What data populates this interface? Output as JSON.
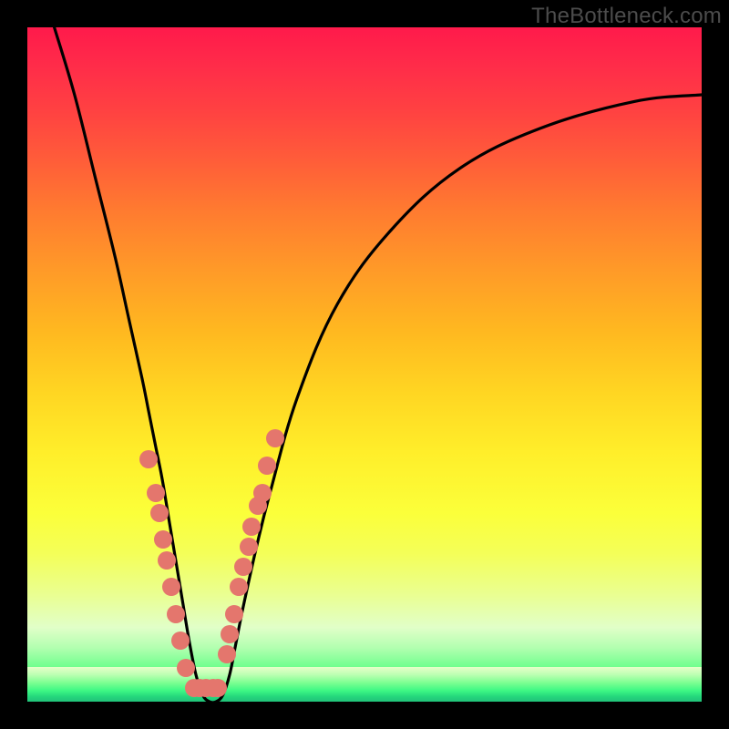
{
  "watermark": "TheBottleneck.com",
  "colors": {
    "frame": "#000000",
    "curve": "#000000",
    "dot": "#e4766d"
  },
  "chart_data": {
    "type": "line",
    "title": "",
    "xlabel": "",
    "ylabel": "",
    "xlim": [
      0,
      100
    ],
    "ylim": [
      0,
      100
    ],
    "grid": false,
    "curve": {
      "name": "bottleneck-curve",
      "description": "V-shaped bottleneck percentage curve. Minimum (0%) near x≈25–28; rises steeply on both sides.",
      "x": [
        4,
        7,
        10,
        13,
        15,
        17,
        18,
        19,
        20,
        21,
        22,
        23,
        24,
        25,
        26,
        27,
        28,
        29,
        30,
        31,
        32,
        34,
        36,
        40,
        46,
        54,
        64,
        76,
        90,
        100
      ],
      "y": [
        100,
        90,
        78,
        66,
        57,
        48,
        43,
        38,
        33,
        27,
        21,
        15,
        9,
        4,
        1,
        0,
        0,
        1,
        4,
        9,
        14,
        23,
        31,
        45,
        59,
        70,
        79,
        85,
        89,
        90
      ]
    },
    "markers": {
      "name": "sample-points",
      "color": "#e4766d",
      "points": [
        {
          "x": 18.0,
          "y": 36
        },
        {
          "x": 19.0,
          "y": 31
        },
        {
          "x": 19.6,
          "y": 28
        },
        {
          "x": 20.2,
          "y": 24
        },
        {
          "x": 20.7,
          "y": 21
        },
        {
          "x": 21.3,
          "y": 17
        },
        {
          "x": 22.0,
          "y": 13
        },
        {
          "x": 22.7,
          "y": 9
        },
        {
          "x": 23.5,
          "y": 5
        },
        {
          "x": 24.7,
          "y": 2
        },
        {
          "x": 25.5,
          "y": 2
        },
        {
          "x": 26.5,
          "y": 2
        },
        {
          "x": 27.5,
          "y": 2
        },
        {
          "x": 28.3,
          "y": 2
        },
        {
          "x": 29.6,
          "y": 7
        },
        {
          "x": 30.0,
          "y": 10
        },
        {
          "x": 30.7,
          "y": 13
        },
        {
          "x": 31.3,
          "y": 17
        },
        {
          "x": 32.0,
          "y": 20
        },
        {
          "x": 32.8,
          "y": 23
        },
        {
          "x": 33.3,
          "y": 26
        },
        {
          "x": 34.2,
          "y": 29
        },
        {
          "x": 34.8,
          "y": 31
        },
        {
          "x": 35.6,
          "y": 35
        },
        {
          "x": 36.8,
          "y": 39
        }
      ]
    },
    "background": {
      "type": "vertical-gradient",
      "description": "Color scale from red (high bottleneck) at top through orange/yellow to green (optimal) at bottom",
      "stops": [
        {
          "pos": 0.0,
          "color": "#ff1a4b"
        },
        {
          "pos": 0.35,
          "color": "#ff9a28"
        },
        {
          "pos": 0.7,
          "color": "#fbff3a"
        },
        {
          "pos": 0.93,
          "color": "#6dff8c"
        },
        {
          "pos": 1.0,
          "color": "#22c97a"
        }
      ]
    }
  }
}
